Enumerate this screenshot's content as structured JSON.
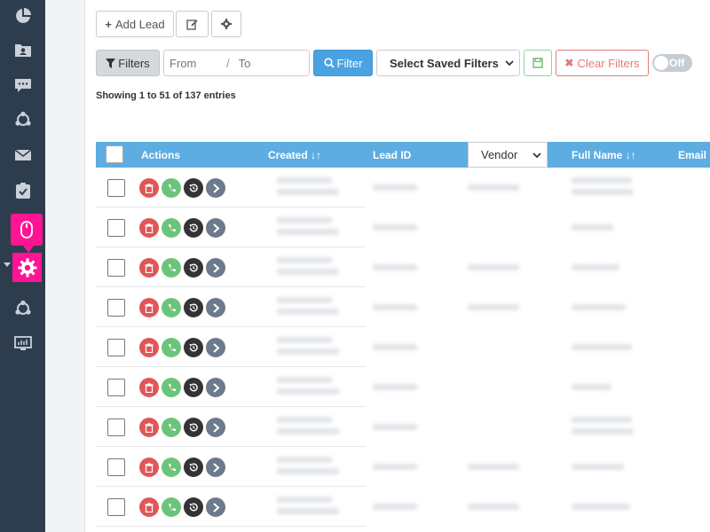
{
  "sidebar": {
    "items": [
      "pie-chart-icon",
      "contacts-folder-icon",
      "chat-icon",
      "share-icon",
      "mail-icon",
      "task-check-icon",
      "mouse-icon",
      "gear-icon",
      "share-icon",
      "monitor-icon"
    ],
    "accent": "#ff1493"
  },
  "toolbar": {
    "add_label": "Add Lead",
    "filters_label": "Filters",
    "from_placeholder": "From",
    "to_placeholder": "To",
    "range_separator": "/",
    "filter_label": "Filter",
    "saved_filters_label": "Select Saved Filters",
    "clear_filters_label": "Clear Filters",
    "toggle_label": "Off"
  },
  "table": {
    "entries_info": "Showing 1 to 51 of 137 entries",
    "columns": {
      "actions": "Actions",
      "created": "Created ↓↑",
      "lead_id": "Lead ID",
      "vendor": "Vendor",
      "full_name": "Full Name ↓↑",
      "email": "Email"
    },
    "row_count": 9,
    "header_color": "#5dade2"
  }
}
